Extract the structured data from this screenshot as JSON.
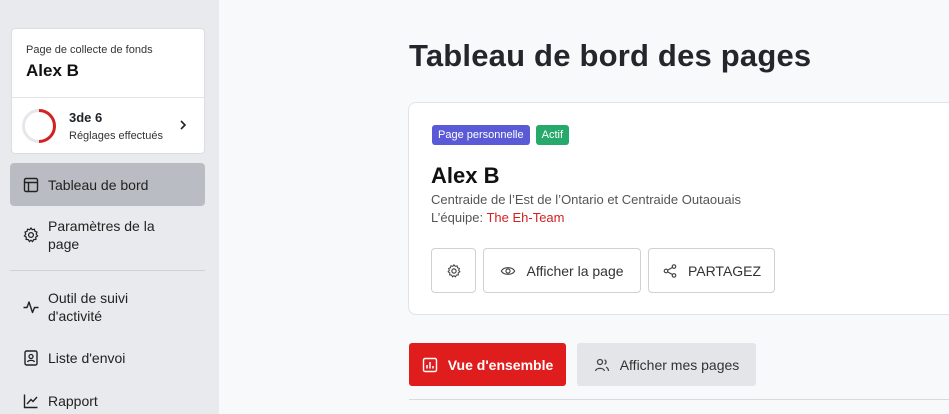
{
  "sidebar": {
    "fund_card": {
      "label": "Page de collecte de fonds",
      "name": "Alex B",
      "progress_count": "3de 6",
      "progress_label": "Réglages effectués",
      "progress_fraction": 0.5,
      "ring_color": "#d32222"
    },
    "nav": {
      "dashboard": "Tableau de bord",
      "settings_line1": "Paramètres de la",
      "settings_line2": "page",
      "tracker_line1": "Outil de suivi",
      "tracker_line2": "d'activité",
      "mailing": "Liste d'envoi",
      "report": "Rapport"
    }
  },
  "main": {
    "title": "Tableau de bord des pages",
    "card": {
      "badge_personal": "Page personnelle",
      "badge_active": "Actif",
      "name": "Alex B",
      "org": "Centraide de l’Est de l’Ontario et Centraide Outaouais",
      "team_label": "L’équipe:",
      "team_name": "The Eh-Team",
      "view_page": "Afficher la page",
      "share": "PARTAGEZ"
    },
    "tabs": {
      "overview": "Vue d'ensemble",
      "my_pages": "Afficher mes pages"
    }
  },
  "colors": {
    "accent_red": "#df1d1d",
    "badge_purple": "#5a5ad6",
    "badge_green": "#27a96b"
  }
}
